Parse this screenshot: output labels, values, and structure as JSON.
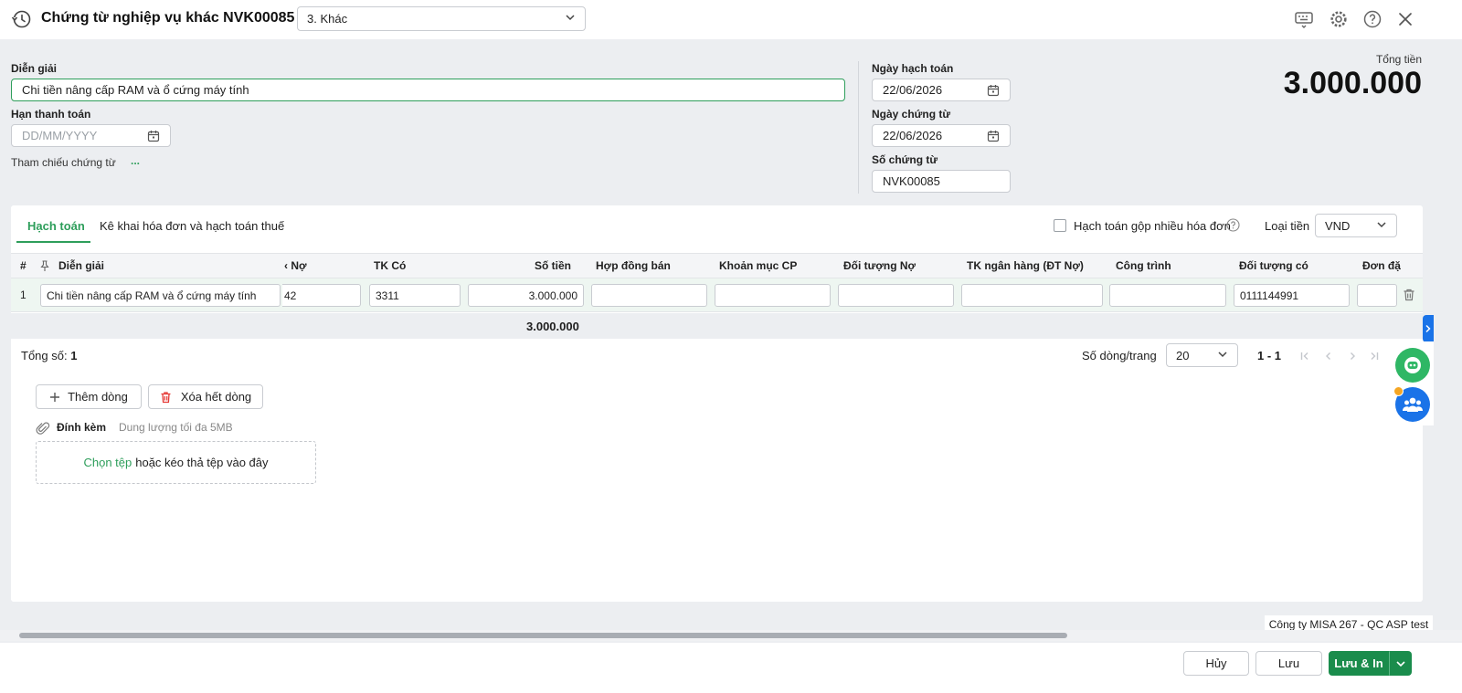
{
  "header": {
    "title": "Chứng từ nghiệp vụ khác NVK00085",
    "voucher_type": "3. Khác",
    "icons": [
      "history-icon",
      "keyboard-icon",
      "gear-icon",
      "help-icon",
      "close-icon"
    ]
  },
  "form": {
    "description_label": "Diễn giải",
    "description_value": "Chi tiền nâng cấp RAM và ổ cứng máy tính",
    "due_date_label": "Hạn thanh toán",
    "due_date_placeholder": "DD/MM/YYYY",
    "reference_label": "Tham chiếu chứng từ",
    "reference_more": "...",
    "posting_date_label": "Ngày hạch toán",
    "posting_date_value": "22/06/2026",
    "voucher_date_label": "Ngày chứng từ",
    "voucher_date_value": "22/06/2026",
    "voucher_no_label": "Số chứng từ",
    "voucher_no_value": "NVK00085"
  },
  "total": {
    "label": "Tổng tiền",
    "value": "3.000.000"
  },
  "tabs": [
    {
      "label": "Hạch toán",
      "active": true
    },
    {
      "label": "Kê khai hóa đơn và hạch toán thuế",
      "active": false
    }
  ],
  "options": {
    "merge_invoices_label": "Hạch toán gộp nhiều hóa đơn",
    "merge_invoices_checked": false,
    "currency_label": "Loại tiền",
    "currency_value": "VND"
  },
  "grid": {
    "columns": [
      "#",
      "Diễn giải",
      "‹ Nợ",
      "TK Có",
      "Số tiền",
      "Hợp đồng bán",
      "Khoản mục CP",
      "Đối tượng Nợ",
      "TK ngân hàng (ĐT Nợ)",
      "Công trình",
      "Đối tượng có",
      "Đơn đặ"
    ],
    "rows": [
      {
        "index": "1",
        "description": "Chi tiền nâng cấp RAM và ổ cứng máy tính",
        "debit_account": "42",
        "credit_account": "3311",
        "amount": "3.000.000",
        "sales_contract": "",
        "expense_item": "",
        "debit_object": "",
        "bank_account": "",
        "project": "",
        "credit_object": "0111144991",
        "order": ""
      }
    ],
    "sum_amount": "3.000.000"
  },
  "footer": {
    "total_count_label": "Tổng số:",
    "total_count_value": "1",
    "rows_per_page_label": "Số dòng/trang",
    "rows_per_page_value": "20",
    "page_range": "1 - 1"
  },
  "actions": {
    "add_row": "Thêm dòng",
    "delete_all_rows": "Xóa hết dòng"
  },
  "attachment": {
    "label": "Đính kèm",
    "limit": "Dung lượng tối đa 5MB",
    "choose_file": "Chọn tệp",
    "drop_text": "hoặc kéo thả tệp vào đây"
  },
  "company": "Công ty MISA 267 - QC ASP test",
  "bottom_buttons": {
    "cancel": "Hủy",
    "save": "Lưu",
    "save_print": "Lưu & In"
  },
  "colors": {
    "accent": "#2e9e5b",
    "brand_dark": "#1a8c4c",
    "chat_blue": "#1a73e8",
    "delete_red": "#e53935"
  }
}
